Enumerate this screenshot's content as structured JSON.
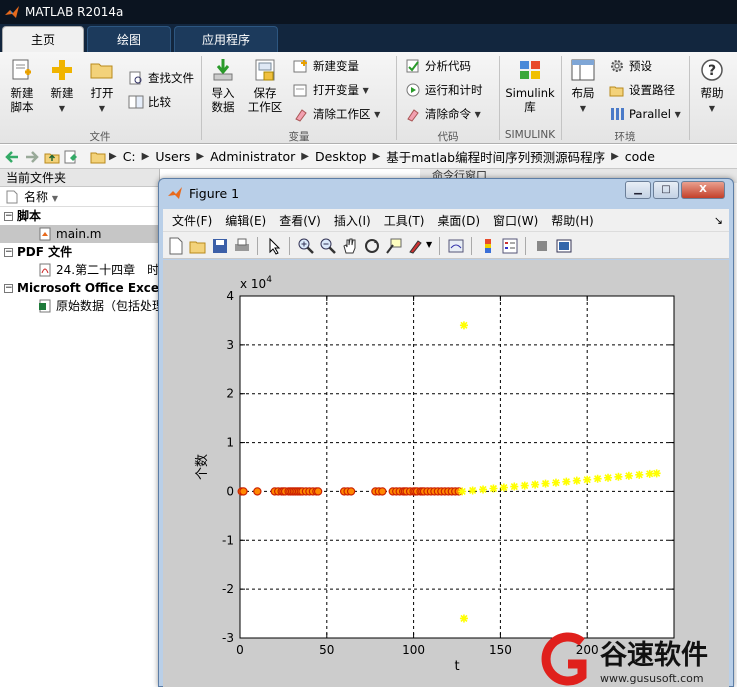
{
  "app": {
    "title": "MATLAB R2014a"
  },
  "tabs": [
    {
      "label": "主页",
      "active": true
    },
    {
      "label": "绘图",
      "active": false
    },
    {
      "label": "应用程序",
      "active": false
    }
  ],
  "ribbon": {
    "file_group": {
      "label": "文件",
      "new_script": "新建\n脚本",
      "new": "新建",
      "open": "打开",
      "find_files": "查找文件",
      "compare": "比较"
    },
    "variable_group": {
      "label": "变量",
      "import": "导入\n数据",
      "save_ws": "保存\n工作区",
      "new_var": "新建变量",
      "open_var": "打开变量",
      "clear_ws": "清除工作区"
    },
    "code_group": {
      "label": "代码",
      "analyze": "分析代码",
      "run_time": "运行和计时",
      "clear_cmd": "清除命令"
    },
    "simulink_group": {
      "label": "SIMULINK",
      "simulink": "Simulink\n库"
    },
    "env_group": {
      "label": "环境",
      "layout": "布局",
      "prefs": "预设",
      "set_path": "设置路径",
      "parallel": "Parallel"
    },
    "help": {
      "label": "帮助"
    }
  },
  "address": {
    "crumbs": [
      "C:",
      "Users",
      "Administrator",
      "Desktop",
      "基于matlab编程时间序列预测源码程序",
      "code"
    ]
  },
  "left_panel": {
    "title": "当前文件夹",
    "column": "名称",
    "groups": [
      {
        "label": "脚本",
        "files": [
          {
            "name": "main.m",
            "selected": true
          }
        ]
      },
      {
        "label": "PDF 文件",
        "files": [
          {
            "name": "24.第二十四章　时"
          }
        ]
      },
      {
        "label": "Microsoft Office Excel",
        "files": [
          {
            "name": "原始数据（包括处理"
          }
        ]
      }
    ]
  },
  "right_panel": {
    "title": "命令行窗口"
  },
  "figure": {
    "title": "Figure 1",
    "menu": [
      "文件(F)",
      "编辑(E)",
      "查看(V)",
      "插入(I)",
      "工具(T)",
      "桌面(D)",
      "窗口(W)",
      "帮助(H)"
    ],
    "min_label": "▁",
    "max_label": "□",
    "close_label": "X"
  },
  "colors": {
    "actual": "#cc2200",
    "actual_fill": "#ff8800",
    "predicted": "#ffff00",
    "title_bar": "#0b1420"
  },
  "chart_data": {
    "type": "scatter",
    "xlabel": "t",
    "ylabel": "个数",
    "y_exponent": "x 10^4",
    "xlim": [
      0,
      250
    ],
    "ylim": [
      -3,
      4
    ],
    "xticks": [
      0,
      50,
      100,
      150,
      200,
      250
    ],
    "yticks": [
      -3,
      -2,
      -1,
      0,
      1,
      2,
      3,
      4
    ],
    "xtick_labels": [
      "0",
      "50",
      "100",
      "150",
      "200"
    ],
    "grid": true,
    "grid_style": "dotted",
    "series": [
      {
        "marker": "circle",
        "color": "#cc2200",
        "x": [
          1,
          2,
          10,
          20,
          22,
          24,
          25,
          26,
          28,
          29,
          30,
          31,
          32,
          33,
          34,
          35,
          36,
          38,
          40,
          42,
          44,
          45,
          60,
          62,
          64,
          78,
          80,
          82,
          88,
          90,
          92,
          94,
          95,
          96,
          98,
          100,
          101,
          102,
          104,
          105,
          106,
          108,
          110,
          112,
          114,
          116,
          118,
          120,
          122,
          124,
          126
        ],
        "y": [
          0,
          0,
          0,
          0,
          0,
          0,
          0,
          0,
          0,
          0,
          0,
          0,
          0,
          0,
          0,
          0,
          0,
          0,
          0,
          0,
          0,
          0,
          0,
          0,
          0,
          0,
          0,
          0,
          0,
          0,
          0,
          0,
          0,
          0,
          0,
          0,
          0,
          0,
          0,
          0,
          0,
          0,
          0,
          0,
          0,
          0,
          0,
          0,
          0,
          0,
          0
        ]
      },
      {
        "marker": "star",
        "color": "#ffff00",
        "x": [
          128,
          134,
          140,
          146,
          152,
          158,
          164,
          170,
          176,
          182,
          188,
          194,
          200,
          206,
          212,
          218,
          224,
          230,
          236,
          240
        ],
        "y": [
          0,
          0.02,
          0.04,
          0.06,
          0.08,
          0.1,
          0.12,
          0.14,
          0.16,
          0.18,
          0.2,
          0.22,
          0.24,
          0.26,
          0.28,
          0.3,
          0.32,
          0.34,
          0.36,
          0.37
        ]
      },
      {
        "marker": "star",
        "color": "#ffff00",
        "x": [
          129,
          129
        ],
        "y": [
          3.4,
          -2.6
        ]
      }
    ]
  },
  "watermark": {
    "brand": "谷速软件",
    "url": "www.gususoft.com"
  }
}
